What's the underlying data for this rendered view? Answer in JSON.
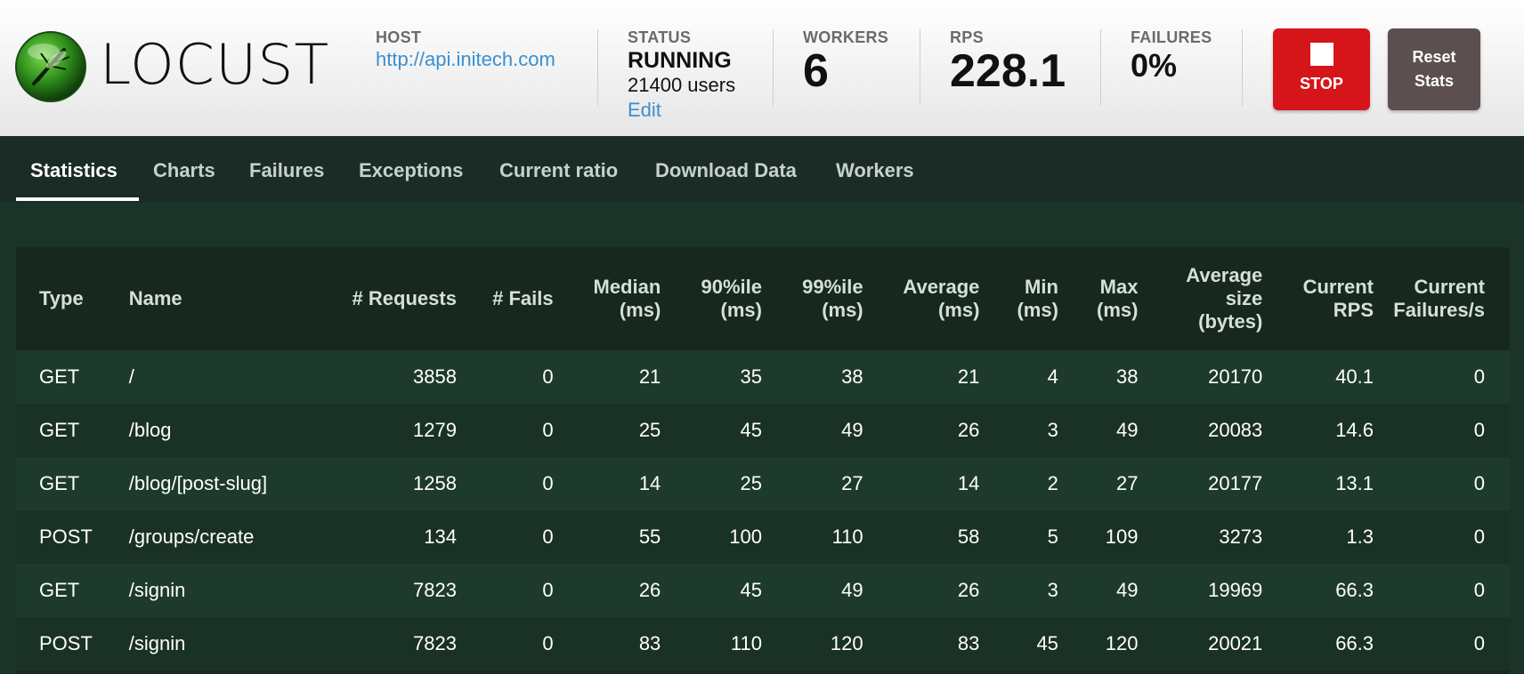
{
  "header": {
    "logo_text": "LOCUST",
    "host": {
      "label": "HOST",
      "value": "http://api.initech.com"
    },
    "status": {
      "label": "STATUS",
      "value": "RUNNING",
      "users": "21400 users",
      "edit": "Edit"
    },
    "workers": {
      "label": "WORKERS",
      "value": "6"
    },
    "rps": {
      "label": "RPS",
      "value": "228.1"
    },
    "failures": {
      "label": "FAILURES",
      "value": "0%"
    },
    "stop_label": "STOP",
    "reset_line1": "Reset",
    "reset_line2": "Stats"
  },
  "tabs": [
    "Statistics",
    "Charts",
    "Failures",
    "Exceptions",
    "Current ratio",
    "Download Data",
    "Workers"
  ],
  "active_tab": "Statistics",
  "table": {
    "headers": [
      [
        "Type"
      ],
      [
        "Name"
      ],
      [
        "# Requests"
      ],
      [
        "# Fails"
      ],
      [
        "Median",
        "(ms)"
      ],
      [
        "90%ile",
        "(ms)"
      ],
      [
        "99%ile",
        "(ms)"
      ],
      [
        "Average",
        "(ms)"
      ],
      [
        "Min",
        "(ms)"
      ],
      [
        "Max",
        "(ms)"
      ],
      [
        "Average",
        "size",
        "(bytes)"
      ],
      [
        "Current",
        "RPS"
      ],
      [
        "Current",
        "Failures/s"
      ]
    ],
    "rows": [
      [
        "GET",
        "/",
        "3858",
        "0",
        "21",
        "35",
        "38",
        "21",
        "4",
        "38",
        "20170",
        "40.1",
        "0"
      ],
      [
        "GET",
        "/blog",
        "1279",
        "0",
        "25",
        "45",
        "49",
        "26",
        "3",
        "49",
        "20083",
        "14.6",
        "0"
      ],
      [
        "GET",
        "/blog/[post-slug]",
        "1258",
        "0",
        "14",
        "25",
        "27",
        "14",
        "2",
        "27",
        "20177",
        "13.1",
        "0"
      ],
      [
        "POST",
        "/groups/create",
        "134",
        "0",
        "55",
        "100",
        "110",
        "58",
        "5",
        "109",
        "3273",
        "1.3",
        "0"
      ],
      [
        "GET",
        "/signin",
        "7823",
        "0",
        "26",
        "45",
        "49",
        "26",
        "3",
        "49",
        "19969",
        "66.3",
        "0"
      ],
      [
        "POST",
        "/signin",
        "7823",
        "0",
        "83",
        "110",
        "120",
        "83",
        "45",
        "120",
        "20021",
        "66.3",
        "0"
      ]
    ]
  },
  "colors": {
    "stop": "#d6151b",
    "reset": "#5c4f4f",
    "link": "#3a8fd0",
    "background": "#1c3329"
  },
  "icons": {
    "logo": "locust-logo-icon",
    "stop": "stop-square-icon"
  }
}
